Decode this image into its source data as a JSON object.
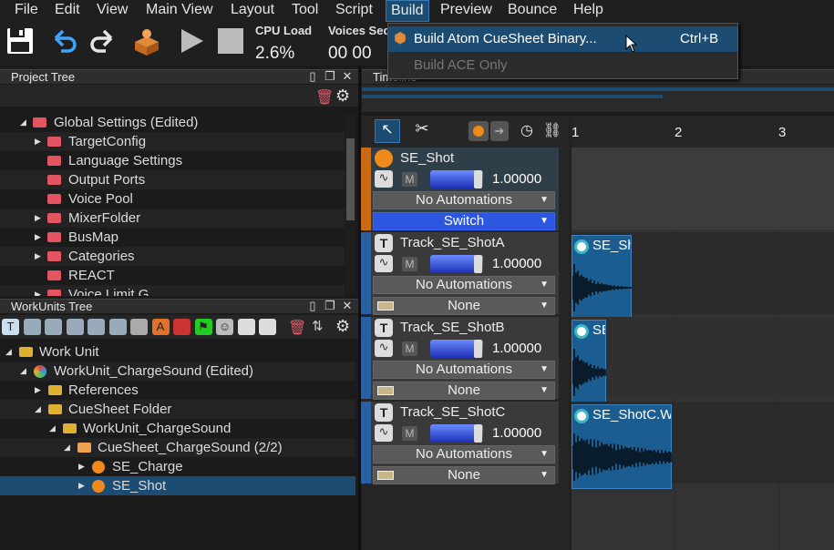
{
  "menu": [
    "File",
    "Edit",
    "View",
    "Main View",
    "Layout",
    "Tool",
    "Script",
    "Build",
    "Preview",
    "Bounce",
    "Help"
  ],
  "toolbar": {
    "cpu_title": "CPU Load",
    "cpu_value": "2.6%",
    "voices_title": "Voices Sequ",
    "voices_value": "00 00"
  },
  "build_menu": {
    "items": [
      {
        "label": "Build Atom CueSheet Binary...",
        "shortcut": "Ctrl+B",
        "enabled": true
      },
      {
        "label": "Build ACE Only",
        "enabled": false
      }
    ]
  },
  "project_tree": {
    "title": "Project Tree",
    "items": [
      {
        "label": "Global Settings (Edited)",
        "level": 0,
        "expanded": true
      },
      {
        "label": "TargetConfig",
        "level": 1,
        "expandable": true
      },
      {
        "label": "Language Settings",
        "level": 1
      },
      {
        "label": "Output Ports",
        "level": 1
      },
      {
        "label": "Voice Pool",
        "level": 1
      },
      {
        "label": "MixerFolder",
        "level": 1,
        "expandable": true
      },
      {
        "label": "BusMap",
        "level": 1,
        "expandable": true
      },
      {
        "label": "Categories",
        "level": 1,
        "expandable": true
      },
      {
        "label": "REACT",
        "level": 1
      },
      {
        "label": "Voice Limit G",
        "level": 1,
        "expandable": true
      }
    ]
  },
  "workunits_tree": {
    "title": "WorkUnits Tree",
    "items": [
      {
        "label": "Work Unit",
        "level": 0,
        "expanded": true,
        "icon": "folder"
      },
      {
        "label": "WorkUnit_ChargeSound (Edited)",
        "level": 1,
        "expanded": true,
        "icon": "workunit"
      },
      {
        "label": "References",
        "level": 2,
        "expandable": true,
        "icon": "folder"
      },
      {
        "label": "CueSheet Folder",
        "level": 2,
        "expanded": true,
        "icon": "folder"
      },
      {
        "label": "WorkUnit_ChargeSound",
        "level": 3,
        "expanded": true,
        "icon": "folder"
      },
      {
        "label": "CueSheet_ChargeSound (2/2)",
        "level": 4,
        "expanded": true,
        "icon": "cuesheet"
      },
      {
        "label": "SE_Charge",
        "level": 5,
        "expandable": true,
        "icon": "cue"
      },
      {
        "label": "SE_Shot",
        "level": 5,
        "expandable": true,
        "icon": "cue-selected",
        "selected": true
      }
    ]
  },
  "timeline": {
    "title": "Timeline",
    "ruler": [
      "1",
      "2",
      "3"
    ]
  },
  "tracks": [
    {
      "name": "SE_Shot",
      "volume": "1.00000",
      "automation": "No Automations",
      "selector": "Switch",
      "color": "#c96a14",
      "type": "cue"
    },
    {
      "name": "Track_SE_ShotA",
      "volume": "1.00000",
      "automation": "No Automations",
      "selector": "None",
      "color": "#2a5fa0",
      "type": "track",
      "clip": "SE_Sh"
    },
    {
      "name": "Track_SE_ShotB",
      "volume": "1.00000",
      "automation": "No Automations",
      "selector": "None",
      "color": "#2a5fa0",
      "type": "track",
      "clip": "SE"
    },
    {
      "name": "Track_SE_ShotC",
      "volume": "1.00000",
      "automation": "No Automations",
      "selector": "None",
      "color": "#2a5fa0",
      "type": "track",
      "clip": "SE_ShotC.W"
    }
  ],
  "labels": {
    "m": "M"
  }
}
